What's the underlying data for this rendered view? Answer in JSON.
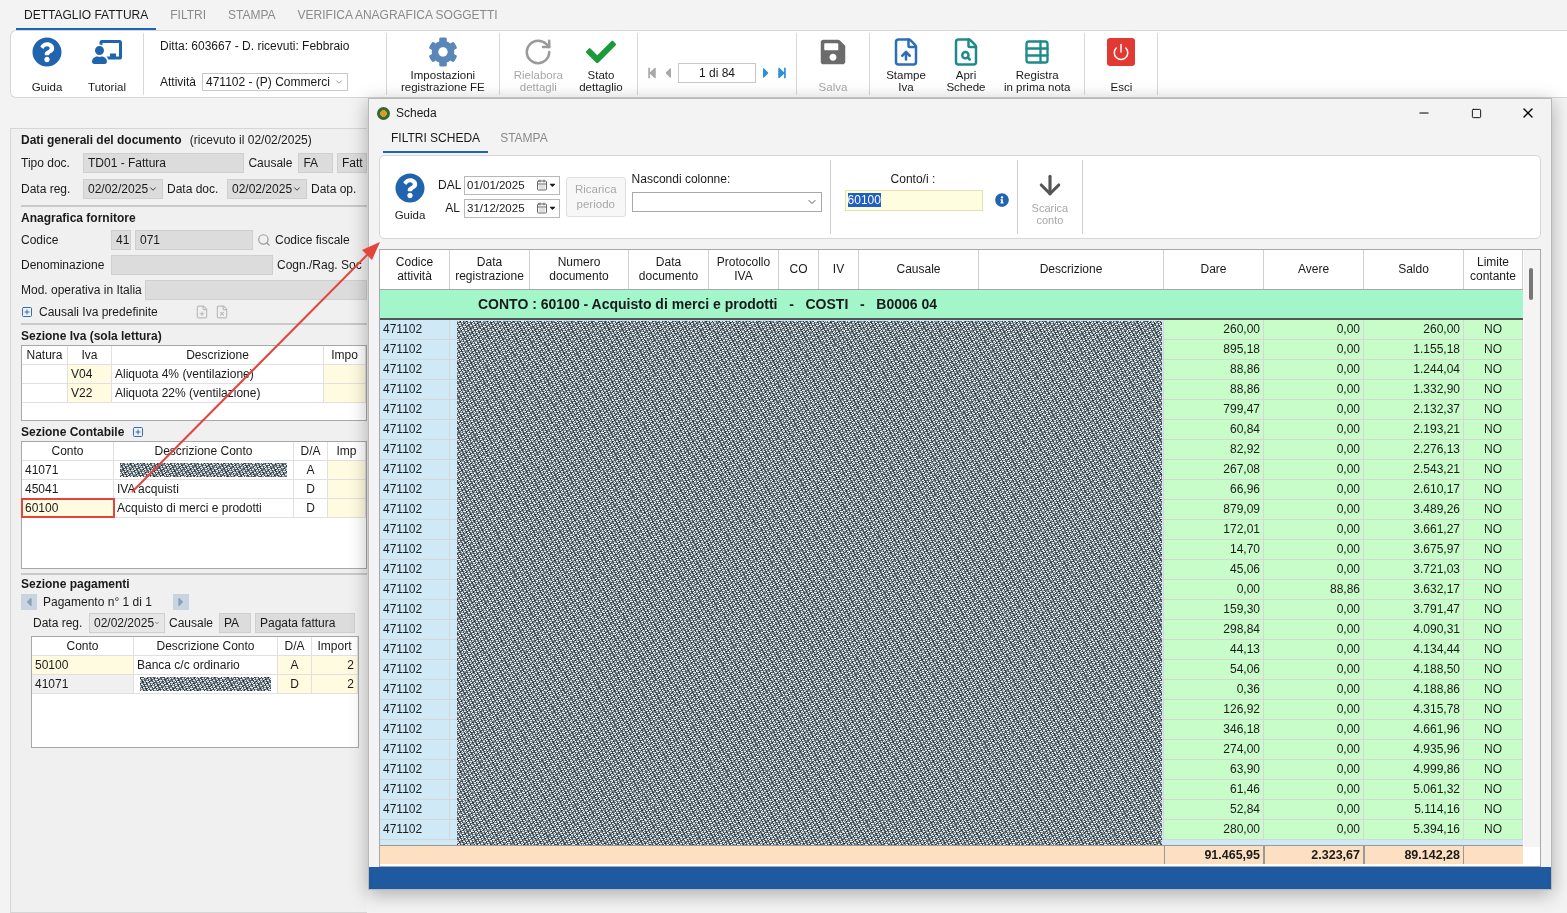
{
  "main_tabs": [
    {
      "label": "DETTAGLIO FATTURA",
      "selected": true
    },
    {
      "label": "FILTRI",
      "selected": false
    },
    {
      "label": "STAMPA",
      "selected": false
    },
    {
      "label": "VERIFICA ANAGRAFICA SOGGETTI",
      "selected": false
    }
  ],
  "toolbar": [
    {
      "items": [
        {
          "kind": "help",
          "label": "Guida",
          "disabled": false
        },
        {
          "kind": "tutorial",
          "label": "Tutorial",
          "disabled": false
        }
      ]
    },
    {
      "items": [
        {
          "kind": "company",
          "ditta": "Ditta: 603667 - D. ricevuti: Febbraio",
          "attivita_label": "Attività",
          "attivita_value": "471102 - (P) Commerci"
        }
      ]
    },
    {
      "items": [
        {
          "kind": "settings",
          "label": "Impostazioni\nregistrazione FE",
          "disabled": false
        }
      ]
    },
    {
      "items": [
        {
          "kind": "refresh",
          "label": "Rielabora\ndettagli",
          "disabled": true
        },
        {
          "kind": "check",
          "label": "Stato\ndettaglio",
          "disabled": false
        }
      ]
    },
    {
      "items": [
        {
          "kind": "pager",
          "value": "1 di 84"
        }
      ]
    },
    {
      "items": [
        {
          "kind": "save",
          "label": "Salva",
          "disabled": true
        }
      ]
    },
    {
      "items": [
        {
          "kind": "print",
          "label": "Stampe\nIva",
          "disabled": false
        },
        {
          "kind": "sheets",
          "label": "Apri\nSchede",
          "disabled": false
        },
        {
          "kind": "register",
          "label": "Registra\nin prima nota",
          "disabled": false
        }
      ]
    },
    {
      "items": [
        {
          "kind": "exit",
          "label": "Esci",
          "disabled": false
        }
      ]
    }
  ],
  "general": {
    "title": "Dati generali del documento",
    "note": "(ricevuto il 02/02/2025)",
    "tipo_doc_label": "Tipo doc.",
    "tipo_doc": "TD01 - Fattura",
    "causale_label": "Causale",
    "causale_code": "FA",
    "causale_desc": "Fatt",
    "data_reg_label": "Data reg.",
    "data_reg": "02/02/2025",
    "data_doc_label": "Data doc.",
    "data_doc": "02/02/2025",
    "data_op_label": "Data op."
  },
  "fornitore": {
    "title": "Anagrafica fornitore",
    "codice_label": "Codice",
    "codice_a": "41",
    "codice_b": "071",
    "cf_label": "Codice fiscale",
    "denominazione_label": "Denominazione",
    "cognome_label": "Cogn./Rag. Soc",
    "mod_label": "Mod. operativa in Italia",
    "causali_label": "Causali Iva predefinite"
  },
  "iva": {
    "title": "Sezione Iva (sola lettura)",
    "columns": [
      "Natura",
      "Iva",
      "Descrizione",
      "Impo"
    ],
    "rows": [
      {
        "iva": "V04",
        "descrizione": "Aliquota 4% (ventilazione)"
      },
      {
        "iva": "V22",
        "descrizione": "Aliquota 22% (ventilazione)"
      }
    ]
  },
  "contabile": {
    "title": "Sezione Contabile",
    "columns": [
      "Conto",
      "Descrizione Conto",
      "D/A",
      "Imp"
    ],
    "rows": [
      {
        "conto": "41071",
        "redacted": true,
        "da": "A",
        "highlighted": false
      },
      {
        "conto": "45041",
        "descrizione": "IVA acquisti",
        "redacted": false,
        "da": "D",
        "highlighted": false
      },
      {
        "conto": "60100",
        "descrizione": "Acquisto di merci e prodotti",
        "redacted": false,
        "da": "D",
        "highlighted": true
      }
    ]
  },
  "pagamenti": {
    "title": "Sezione pagamenti",
    "pager": "Pagamento n° 1 di 1",
    "data_reg_label": "Data reg.",
    "data_reg": "02/02/2025",
    "causale_label": "Causale",
    "causale_code": "PA",
    "causale_desc": "Pagata fattura",
    "columns": [
      "Conto",
      "Descrizione Conto",
      "D/A",
      "Import"
    ],
    "rows": [
      {
        "conto": "50100",
        "descrizione": "Banca c/c ordinario",
        "redacted": false,
        "da": "A",
        "importo": "2"
      },
      {
        "conto": "41071",
        "redacted": true,
        "da": "D",
        "importo": "2"
      }
    ]
  },
  "scheda": {
    "title": "Scheda",
    "tabs": [
      {
        "label": "FILTRI SCHEDA",
        "selected": true
      },
      {
        "label": "STAMPA",
        "selected": false
      }
    ],
    "filters": {
      "guida": "Guida",
      "dal_label": "DAL",
      "dal": "01/01/2025",
      "al_label": "AL",
      "al": "31/12/2025",
      "reload": "Ricarica\nperiodo",
      "reload_disabled": true,
      "hide_label": "Nascondi colonne:",
      "conto_label": "Conto/i :",
      "conto_value": "60100",
      "download": "Scarica\nconto",
      "download_disabled": true
    },
    "table": {
      "columns": [
        "Codice\nattività",
        "Data\nregistrazione",
        "Numero\ndocumento",
        "Data\ndocumento",
        "Protocollo\nIVA",
        "CO",
        "IV",
        "Causale",
        "Descrizione",
        "Dare",
        "Avere",
        "Saldo",
        "Limite\ncontante"
      ],
      "group_header": "CONTO : 60100 - Acquisto di merci e prodotti   -   COSTI   -   B0006 04",
      "rows": [
        {
          "attivita": "471102",
          "dare": "260,00",
          "avere": "0,00",
          "saldo": "260,00",
          "limite": "NO"
        },
        {
          "attivita": "471102",
          "dare": "895,18",
          "avere": "0,00",
          "saldo": "1.155,18",
          "limite": "NO"
        },
        {
          "attivita": "471102",
          "dare": "88,86",
          "avere": "0,00",
          "saldo": "1.244,04",
          "limite": "NO"
        },
        {
          "attivita": "471102",
          "dare": "88,86",
          "avere": "0,00",
          "saldo": "1.332,90",
          "limite": "NO"
        },
        {
          "attivita": "471102",
          "dare": "799,47",
          "avere": "0,00",
          "saldo": "2.132,37",
          "limite": "NO"
        },
        {
          "attivita": "471102",
          "dare": "60,84",
          "avere": "0,00",
          "saldo": "2.193,21",
          "limite": "NO"
        },
        {
          "attivita": "471102",
          "dare": "82,92",
          "avere": "0,00",
          "saldo": "2.276,13",
          "limite": "NO"
        },
        {
          "attivita": "471102",
          "dare": "267,08",
          "avere": "0,00",
          "saldo": "2.543,21",
          "limite": "NO"
        },
        {
          "attivita": "471102",
          "dare": "66,96",
          "avere": "0,00",
          "saldo": "2.610,17",
          "limite": "NO"
        },
        {
          "attivita": "471102",
          "dare": "879,09",
          "avere": "0,00",
          "saldo": "3.489,26",
          "limite": "NO"
        },
        {
          "attivita": "471102",
          "dare": "172,01",
          "avere": "0,00",
          "saldo": "3.661,27",
          "limite": "NO"
        },
        {
          "attivita": "471102",
          "dare": "14,70",
          "avere": "0,00",
          "saldo": "3.675,97",
          "limite": "NO"
        },
        {
          "attivita": "471102",
          "dare": "45,06",
          "avere": "0,00",
          "saldo": "3.721,03",
          "limite": "NO"
        },
        {
          "attivita": "471102",
          "dare": "0,00",
          "avere": "88,86",
          "saldo": "3.632,17",
          "limite": "NO"
        },
        {
          "attivita": "471102",
          "dare": "159,30",
          "avere": "0,00",
          "saldo": "3.791,47",
          "limite": "NO"
        },
        {
          "attivita": "471102",
          "dare": "298,84",
          "avere": "0,00",
          "saldo": "4.090,31",
          "limite": "NO"
        },
        {
          "attivita": "471102",
          "dare": "44,13",
          "avere": "0,00",
          "saldo": "4.134,44",
          "limite": "NO"
        },
        {
          "attivita": "471102",
          "dare": "54,06",
          "avere": "0,00",
          "saldo": "4.188,50",
          "limite": "NO"
        },
        {
          "attivita": "471102",
          "dare": "0,36",
          "avere": "0,00",
          "saldo": "4.188,86",
          "limite": "NO"
        },
        {
          "attivita": "471102",
          "dare": "126,92",
          "avere": "0,00",
          "saldo": "4.315,78",
          "limite": "NO"
        },
        {
          "attivita": "471102",
          "dare": "346,18",
          "avere": "0,00",
          "saldo": "4.661,96",
          "limite": "NO"
        },
        {
          "attivita": "471102",
          "dare": "274,00",
          "avere": "0,00",
          "saldo": "4.935,96",
          "limite": "NO"
        },
        {
          "attivita": "471102",
          "dare": "63,90",
          "avere": "0,00",
          "saldo": "4.999,86",
          "limite": "NO"
        },
        {
          "attivita": "471102",
          "dare": "61,46",
          "avere": "0,00",
          "saldo": "5.061,32",
          "limite": "NO"
        },
        {
          "attivita": "471102",
          "dare": "52,84",
          "avere": "0,00",
          "saldo": "5.114,16",
          "limite": "NO"
        },
        {
          "attivita": "471102",
          "dare": "280,00",
          "avere": "0,00",
          "saldo": "5.394,16",
          "limite": "NO"
        }
      ],
      "totals": {
        "dare": "91.465,95",
        "avere": "2.323,67",
        "saldo": "89.142,28"
      }
    }
  }
}
